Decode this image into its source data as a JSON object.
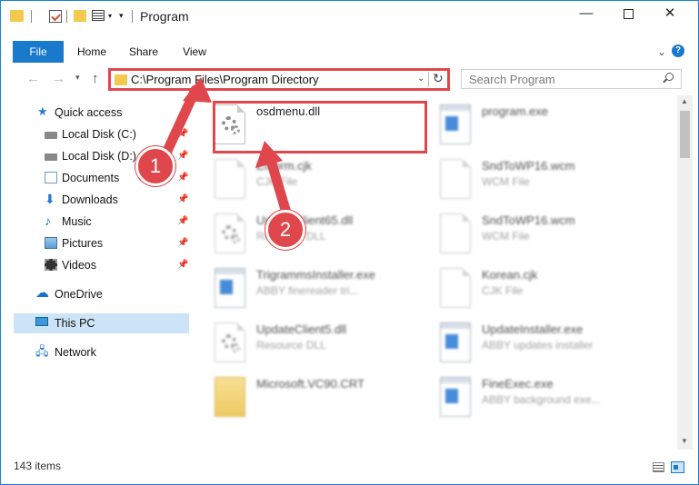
{
  "window": {
    "title": "Program"
  },
  "ribbon": {
    "tabs": [
      "File",
      "Home",
      "Share",
      "View"
    ]
  },
  "address": {
    "path": "C:\\Program Files\\Program Directory"
  },
  "search": {
    "placeholder": "Search Program"
  },
  "sidebar": {
    "items": [
      {
        "label": "Quick access",
        "icon": "star-icon"
      },
      {
        "label": "Local Disk (C:)",
        "icon": "disk-icon",
        "pinned": true
      },
      {
        "label": "Local Disk (D:)",
        "icon": "disk-icon",
        "pinned": true
      },
      {
        "label": "Documents",
        "icon": "documents-icon",
        "pinned": true
      },
      {
        "label": "Downloads",
        "icon": "download-arrow-icon",
        "pinned": true
      },
      {
        "label": "Music",
        "icon": "music-note-icon",
        "pinned": true
      },
      {
        "label": "Pictures",
        "icon": "pictures-icon",
        "pinned": true
      },
      {
        "label": "Videos",
        "icon": "film-icon",
        "pinned": true
      },
      {
        "label": "OneDrive",
        "icon": "cloud-icon"
      },
      {
        "label": "This PC",
        "icon": "computer-icon",
        "selected": true
      },
      {
        "label": "Network",
        "icon": "network-icon"
      }
    ]
  },
  "files": [
    {
      "name": "osdmenu.dll",
      "desc": "",
      "icon": "dll-gear-icon"
    },
    {
      "name": "program.exe",
      "desc": "",
      "icon": "exe-icon"
    },
    {
      "name": "Effform.cjk",
      "desc": "CJK File",
      "icon": "blank-file-icon"
    },
    {
      "name": "SndToWP16.wcm",
      "desc": "WCM File",
      "icon": "blank-file-icon"
    },
    {
      "name": "UpdateClient65.dll",
      "desc": "Resource DLL",
      "icon": "dll-gear-icon"
    },
    {
      "name": "SndToWP16.wcm",
      "desc": "WCM File",
      "icon": "blank-file-icon"
    },
    {
      "name": "TrigrammsInstaller.exe",
      "desc": "ABBY finereader tri...",
      "icon": "app-window-icon"
    },
    {
      "name": "Korean.cjk",
      "desc": "CJK File",
      "icon": "blank-file-icon"
    },
    {
      "name": "UpdateClient5.dll",
      "desc": "Resource DLL",
      "icon": "dll-gear-icon"
    },
    {
      "name": "UpdateInstaller.exe",
      "desc": "ABBY updates installer",
      "icon": "app-window-icon"
    },
    {
      "name": "Microsoft.VC90.CRT",
      "desc": "",
      "icon": "folder-icon"
    },
    {
      "name": "FineExec.exe",
      "desc": "ABBY background exe...",
      "icon": "app-window-icon"
    }
  ],
  "status": {
    "count": "143 items"
  },
  "annotations": {
    "step1": "1",
    "step2": "2",
    "accent": "#e0474c"
  }
}
